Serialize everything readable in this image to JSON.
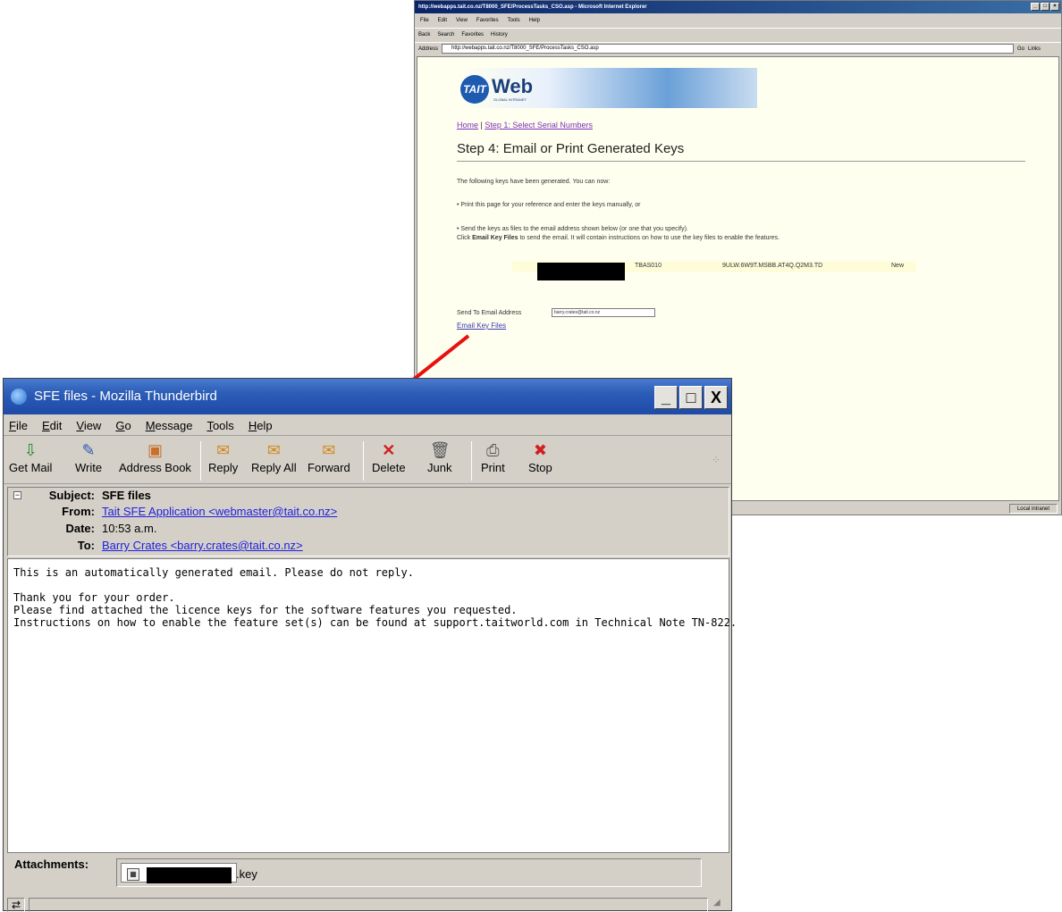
{
  "ie": {
    "title": "http://webapps.tait.co.nz/T8000_SFE/ProcessTasks_CSO.asp - Microsoft Internet Explorer",
    "menu": [
      "File",
      "Edit",
      "View",
      "Favorites",
      "Tools",
      "Help"
    ],
    "toolbar": [
      "Back",
      "Search",
      "Favorites",
      "History"
    ],
    "address_label": "Address",
    "address_value": "http://webapps.tait.co.nz/T8000_SFE/ProcessTasks_CSO.asp",
    "go_label": "Go",
    "links_label": "Links",
    "status_zone": "Local intranet",
    "page": {
      "logo_badge": "TAIT",
      "logo_text": "Web",
      "logo_sub": "GLOBAL INTRANET",
      "crumb_home": "Home",
      "crumb_sep": "|",
      "crumb_step1": "Step 1: Select Serial Numbers",
      "heading": "Step 4: Email or Print Generated Keys",
      "intro": "The following keys have been generated. You can now:",
      "bullet1": "• Print this page for your reference and enter the keys manually, or",
      "bullet2": "• Send the keys as files to the email address shown below (or one that you specify).",
      "click_prefix": "Click",
      "click_bold": "Email Key Files",
      "click_suffix": "to send the email. It will contain instructions on how to use the key files to enable the features.",
      "key_model": "TBAS010",
      "key_code": "9ULW.6W9T.MSBB.AT4Q.Q2M3.TD",
      "key_status": "New",
      "send_label": "Send To Email Address",
      "send_value": "barry.crates@tait.co.nz",
      "email_link": "Email Key Files"
    }
  },
  "thunderbird": {
    "title": "SFE files - Mozilla Thunderbird",
    "window_buttons": [
      "_",
      "□",
      "X"
    ],
    "menu": [
      "File",
      "Edit",
      "View",
      "Go",
      "Message",
      "Tools",
      "Help"
    ],
    "toolbar": [
      "Get Mail",
      "Write",
      "Address Book",
      "Reply",
      "Reply All",
      "Forward",
      "Delete",
      "Junk",
      "Print",
      "Stop"
    ],
    "header": {
      "subject_label": "Subject:",
      "subject_value": "SFE files",
      "from_label": "From:",
      "from_value": "Tait SFE Application <webmaster@tait.co.nz>",
      "date_label": "Date:",
      "date_value": "10:53 a.m.",
      "to_label": "To:",
      "to_value": "Barry Crates <barry.crates@tait.co.nz>"
    },
    "body_lines": [
      "This is an automatically generated email. Please do not reply.",
      "",
      "Thank you for your order.",
      "Please find attached the licence keys for the software features you requested.",
      "Instructions on how to enable the feature set(s) can be found at support.taitworld.com in Technical Note TN-822."
    ],
    "attachments_label": "Attachments:",
    "attachment_ext": ".key"
  },
  "colors": {
    "arrow": "#e81010",
    "link": "#2020e0",
    "page_bg": "#fffff0"
  }
}
